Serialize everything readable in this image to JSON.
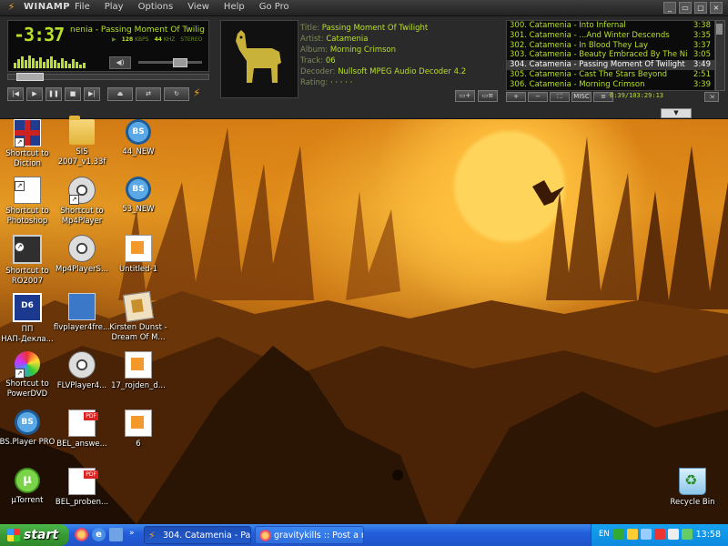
{
  "winamp": {
    "title": "WINAMP",
    "menu": [
      "File",
      "Play",
      "Options",
      "View",
      "Help",
      "Go Pro"
    ],
    "time": "-3:37",
    "scroll_text": "nenia - Passing Moment Of Twilight (3:49)",
    "bitrate": "128",
    "bitrate_unit": "KBPS",
    "samplerate": "44",
    "samplerate_unit": "KHZ",
    "stereo": "STEREO",
    "info": {
      "title_label": "Title:",
      "title": "Passing Moment Of Twilight",
      "artist_label": "Artist:",
      "artist": "Catamenia",
      "album_label": "Album:",
      "album": "Morning Crimson",
      "track_label": "Track:",
      "track": "06",
      "decoder_label": "Decoder:",
      "decoder": "Nullsoft MPEG Audio Decoder 4.2",
      "rating_label": "Rating:",
      "rating": "· · · · ·"
    },
    "playlist": [
      {
        "title": "300. Catamenia - Into Infernal",
        "duration": "3:38"
      },
      {
        "title": "301. Catamenia - ...And Winter Descends",
        "duration": "3:35"
      },
      {
        "title": "302. Catamenia - In Blood They Lay",
        "duration": "3:37"
      },
      {
        "title": "303. Catamenia - Beauty Embraced By The Night",
        "duration": "3:05"
      },
      {
        "title": "304. Catamenia - Passing Moment Of Twilight",
        "duration": "3:49"
      },
      {
        "title": "305. Catamenia - Cast The Stars Beyond",
        "duration": "2:51"
      },
      {
        "title": "306. Catamenia - Morning Crimson",
        "duration": "3:39"
      }
    ],
    "playlist_buttons": [
      "+",
      "−",
      "⛶",
      "MISC",
      "≡"
    ],
    "playlist_time": "6:39/103:29:13"
  },
  "desktop_icons": [
    {
      "label": "Shortcut to\nDiction"
    },
    {
      "label": "SIS\n2007_v1.33f"
    },
    {
      "label": "44_NEW"
    },
    {
      "label": "Shortcut to\nPhotoshop"
    },
    {
      "label": "Shortcut to\nMp4Player"
    },
    {
      "label": "53_NEW"
    },
    {
      "label": "Shortcut to\nRO2007"
    },
    {
      "label": "Mp4PlayerS..."
    },
    {
      "label": "Untitled-1"
    },
    {
      "label": "ПП\nНАП-Декла..."
    },
    {
      "label": "flvplayer4fre..."
    },
    {
      "label": "Kirsten Dunst -\nDream Of M..."
    },
    {
      "label": "Shortcut to\nPowerDVD"
    },
    {
      "label": "FLVPlayer4..."
    },
    {
      "label": "17_rojden_d..."
    },
    {
      "label": "BS.Player PRO"
    },
    {
      "label": "BEL_answe..."
    },
    {
      "label": "6"
    },
    {
      "label": "µTorrent"
    },
    {
      "label": "BEL_proben..."
    },
    {
      "label": "Recycle Bin"
    }
  ],
  "taskbar": {
    "start_label": "start",
    "tasks": [
      {
        "label": "304. Catamenia - Pas..."
      },
      {
        "label": "gravitykills :: Post a n..."
      }
    ],
    "language": "EN",
    "clock": "13:58"
  }
}
